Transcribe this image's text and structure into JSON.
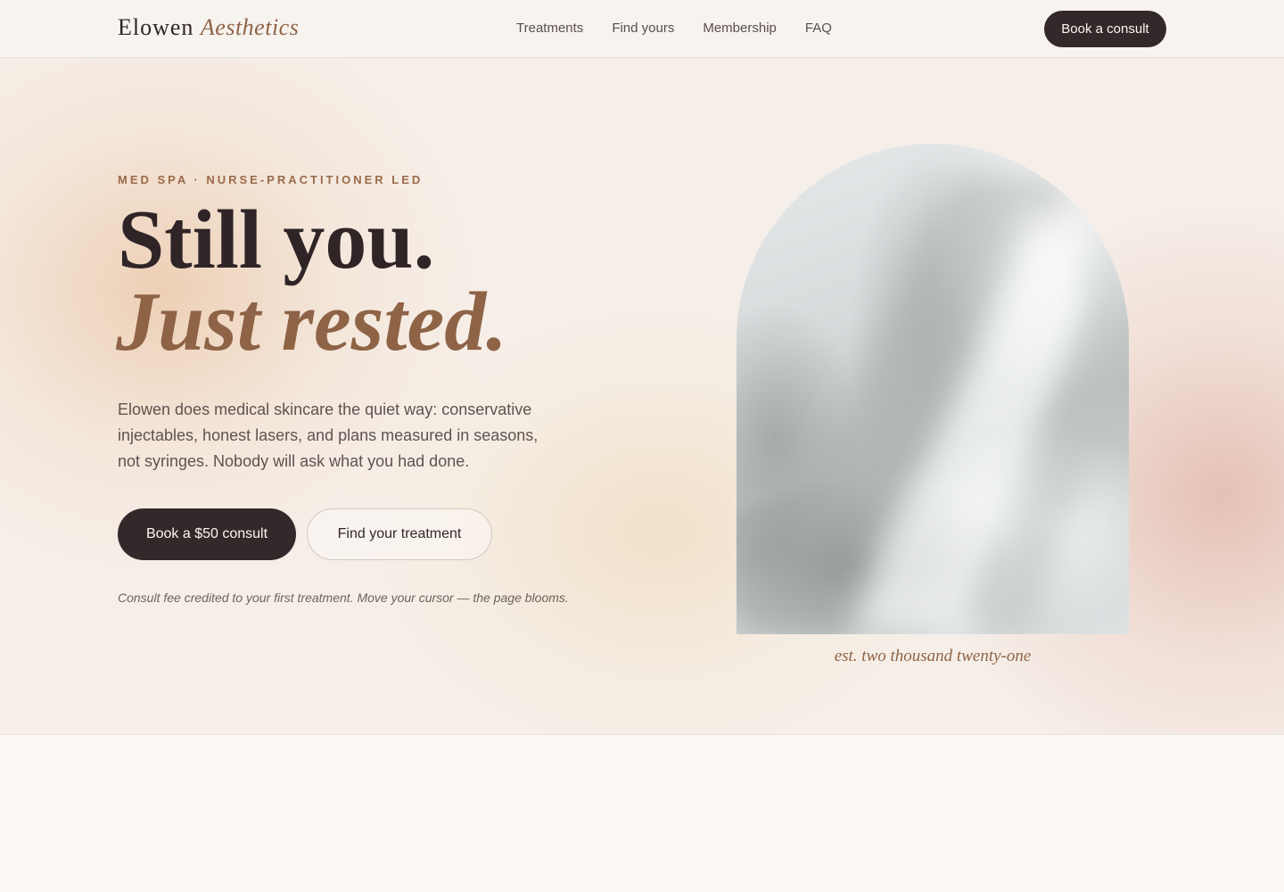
{
  "header": {
    "logo_primary": "Elowen",
    "logo_accent": "Aesthetics",
    "nav": [
      "Treatments",
      "Find yours",
      "Membership",
      "FAQ"
    ],
    "cta_label": "Book a consult"
  },
  "hero": {
    "eyebrow": "MED SPA · NURSE-PRACTITIONER LED",
    "headline_line1": "Still you.",
    "headline_line2": "Just rested.",
    "lede": "Elowen does medical skincare the quiet way: conservative injectables, honest lasers, and plans measured in seasons, not syringes. Nobody will ask what you had done.",
    "primary_cta": "Book a $50 consult",
    "secondary_cta": "Find your treatment",
    "fineprint": "Consult fee credited to your first treatment. Move your cursor — the page blooms.",
    "image_caption": "est. two thousand twenty-one"
  },
  "colors": {
    "ink": "#33282a",
    "accent": "#8e6346",
    "background": "#f6efe9"
  }
}
